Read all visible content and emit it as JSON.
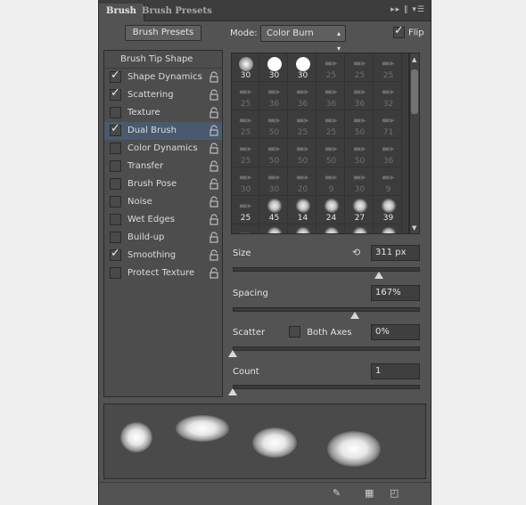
{
  "tabs": {
    "active": "Brush",
    "inactive": "Brush Presets"
  },
  "toolbar": {
    "presets_button": "Brush Presets",
    "mode_label": "Mode:",
    "mode_value": "Color Burn",
    "flip_label": "Flip",
    "flip_checked": true
  },
  "sections": [
    {
      "label": "Brush Tip Shape",
      "checked": null,
      "selected": false
    },
    {
      "label": "Shape Dynamics",
      "checked": true,
      "selected": false
    },
    {
      "label": "Scattering",
      "checked": true,
      "selected": false
    },
    {
      "label": "Texture",
      "checked": false,
      "selected": false
    },
    {
      "label": "Dual Brush",
      "checked": true,
      "selected": true
    },
    {
      "label": "Color Dynamics",
      "checked": false,
      "selected": false
    },
    {
      "label": "Transfer",
      "checked": false,
      "selected": false
    },
    {
      "label": "Brush Pose",
      "checked": false,
      "selected": false
    },
    {
      "label": "Noise",
      "checked": false,
      "selected": false
    },
    {
      "label": "Wet Edges",
      "checked": false,
      "selected": false
    },
    {
      "label": "Build-up",
      "checked": false,
      "selected": false
    },
    {
      "label": "Smoothing",
      "checked": true,
      "selected": false
    },
    {
      "label": "Protect Texture",
      "checked": false,
      "selected": false
    }
  ],
  "brush_tips": [
    [
      "30",
      "30",
      "30",
      "25",
      "25",
      "25"
    ],
    [
      "25",
      "36",
      "36",
      "36",
      "36",
      "32"
    ],
    [
      "25",
      "50",
      "25",
      "25",
      "50",
      "71"
    ],
    [
      "25",
      "50",
      "50",
      "50",
      "50",
      "36"
    ],
    [
      "30",
      "30",
      "20",
      "9",
      "30",
      "9"
    ],
    [
      "25",
      "45",
      "14",
      "24",
      "27",
      "39"
    ],
    [
      "",
      "",
      "",
      "",
      "",
      ""
    ]
  ],
  "controls": {
    "size_label": "Size",
    "size_value": "311 px",
    "size_level": 0.8,
    "spacing_label": "Spacing",
    "spacing_value": "167%",
    "spacing_level": 0.67,
    "scatter_label": "Scatter",
    "both_axes_label": "Both Axes",
    "scatter_value": "0%",
    "scatter_level": 0,
    "count_label": "Count",
    "count_value": "1",
    "count_level": 0
  },
  "icons": {
    "reset": "reset-icon",
    "panel_menu": "panel-menu-icon"
  }
}
